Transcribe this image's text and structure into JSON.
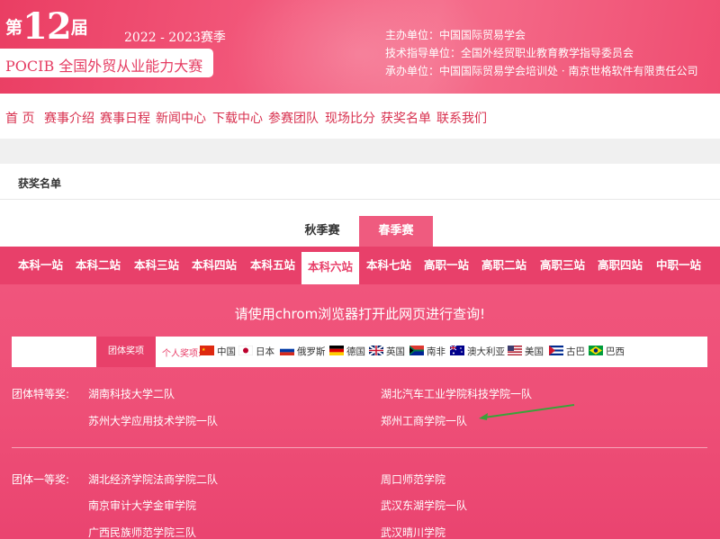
{
  "banner": {
    "edition_prefix": "第",
    "edition_number": "12",
    "edition_suffix": "届",
    "season": "2022 - 2023赛季",
    "brand": "POCIB 全国外贸从业能力大赛",
    "organizers": [
      "主办单位：中国国际贸易学会",
      "技术指导单位：全国外经贸职业教育教学指导委员会",
      "承办单位：中国国际贸易学会培训处 · 南京世格软件有限责任公司"
    ]
  },
  "nav": [
    "首 页",
    "赛事介绍",
    "赛事日程",
    "新闻中心",
    "下载中心",
    "参赛团队",
    "现场比分",
    "获奖名单",
    "联系我们"
  ],
  "breadcrumb": "获奖名单",
  "season_tabs": [
    "秋季赛",
    "春季赛"
  ],
  "stations": [
    "本科一站",
    "本科二站",
    "本科三站",
    "本科四站",
    "本科五站",
    "本科六站",
    "本科七站",
    "高职一站",
    "高职二站",
    "高职三站",
    "高职四站",
    "中职一站"
  ],
  "active_station": "本科六站",
  "notice": "请使用chrom浏览器打开此网页进行查询!",
  "filter": {
    "team_award": "团体奖项",
    "individual_label": "个人奖项:",
    "countries": [
      "中国",
      "日本",
      "俄罗斯",
      "德国",
      "英国",
      "南非",
      "澳大利亚",
      "美国",
      "古巴",
      "巴西"
    ]
  },
  "awards": {
    "special_label": "团体特等奖:",
    "special": [
      "湖南科技大学二队",
      "湖北汽车工业学院科技学院一队",
      "苏州大学应用技术学院一队",
      "郑州工商学院一队"
    ],
    "first_label": "团体一等奖:",
    "first": [
      "湖北经济学院法商学院二队",
      "周口师范学院",
      "南京审计大学金审学院",
      "武汉东湖学院一队",
      "广西民族师范学院三队",
      "武汉晴川学院"
    ]
  },
  "colors": {
    "accent": "#e8406a",
    "banner": "#ea3e63",
    "arrow": "#3aa23a"
  }
}
